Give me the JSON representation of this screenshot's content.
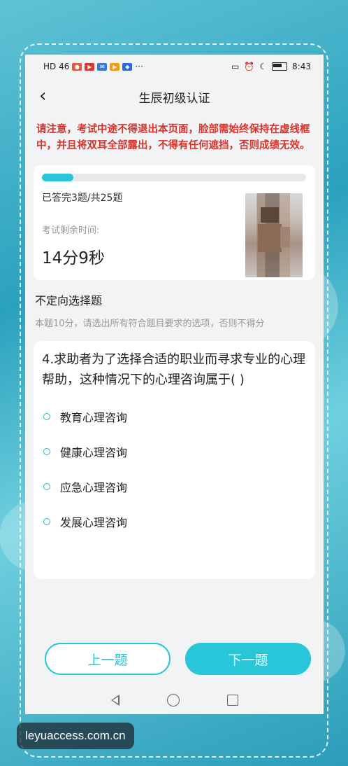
{
  "status_bar": {
    "left_text": "HD 46",
    "time": "8:43",
    "more": "···"
  },
  "header": {
    "title": "生辰初级认证",
    "back_glyph": "‹"
  },
  "warning": "请注意，考试中途不得退出本页面，脸部需始终保持在虚线框中，并且将双耳全部露出，不得有任何遮挡，否则成绩无效。",
  "progress": {
    "answered_text": "已答完3题/共25题",
    "answered": 3,
    "total": 25,
    "fraction": 0.12,
    "remaining_label": "考试剩余时间:",
    "remaining_time": "14分9秒"
  },
  "question": {
    "type": "不定向选择题",
    "instructions": "本题10分，请选出所有符合题目要求的选项，否则不得分",
    "text": "4.求助者为了选择合适的职业而寻求专业的心理帮助，这种情况下的心理咨询属于(    )",
    "options": [
      "教育心理咨询",
      "健康心理咨询",
      "应急心理咨询",
      "发展心理咨询"
    ]
  },
  "buttons": {
    "prev": "上一题",
    "next": "下一题"
  },
  "watermark": "leyuaccess.com.cn",
  "colors": {
    "accent": "#27c6d8",
    "warning": "#d9332b"
  }
}
